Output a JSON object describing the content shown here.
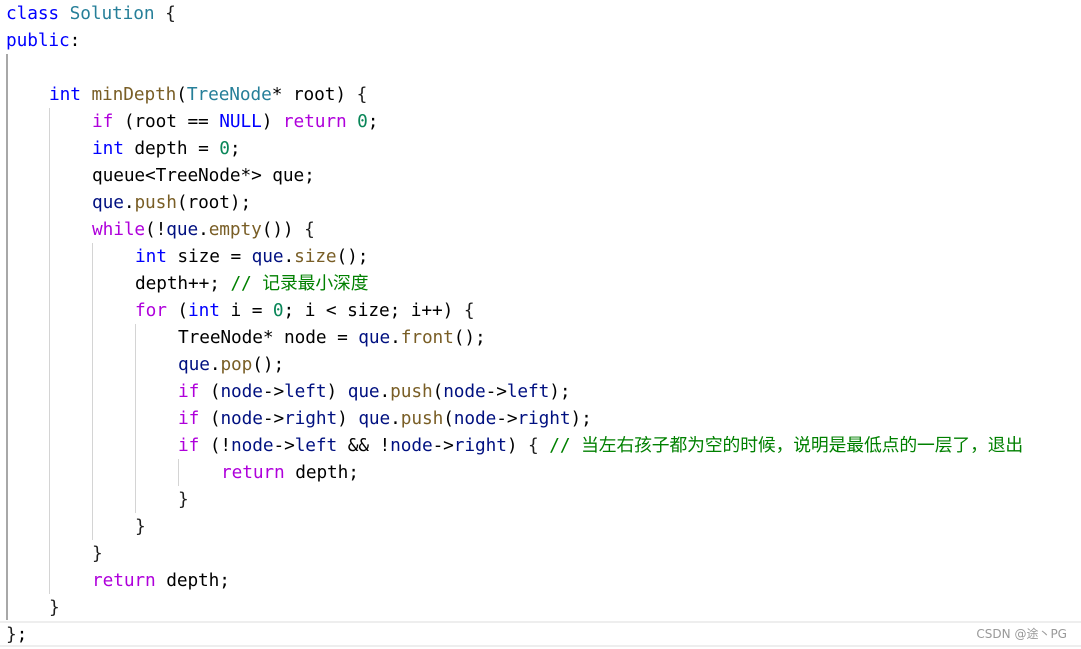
{
  "editor": {
    "language": "cpp",
    "lines": [
      {
        "indent": 0,
        "tokens": [
          [
            "kw",
            "class"
          ],
          [
            "t",
            " "
          ],
          [
            "type",
            "Solution"
          ],
          [
            "t",
            " "
          ],
          [
            "brk",
            "{"
          ]
        ]
      },
      {
        "indent": 0,
        "tokens": [
          [
            "kw",
            "public"
          ],
          [
            "t",
            ":"
          ]
        ]
      },
      {
        "indent": 0,
        "tokens": []
      },
      {
        "indent": 1,
        "tokens": [
          [
            "kw",
            "int"
          ],
          [
            "t",
            " "
          ],
          [
            "fn",
            "minDepth"
          ],
          [
            "t",
            "("
          ],
          [
            "type",
            "TreeNode"
          ],
          [
            "t",
            "* root) "
          ],
          [
            "brk",
            "{"
          ]
        ]
      },
      {
        "indent": 2,
        "tokens": [
          [
            "ctrl",
            "if"
          ],
          [
            "t",
            " (root == "
          ],
          [
            "kw",
            "NULL"
          ],
          [
            "t",
            ") "
          ],
          [
            "ctrl",
            "return"
          ],
          [
            "t",
            " "
          ],
          [
            "num",
            "0"
          ],
          [
            "t",
            ";"
          ]
        ]
      },
      {
        "indent": 2,
        "tokens": [
          [
            "kw",
            "int"
          ],
          [
            "t",
            " depth = "
          ],
          [
            "num",
            "0"
          ],
          [
            "t",
            ";"
          ]
        ]
      },
      {
        "indent": 2,
        "tokens": [
          [
            "t",
            "queue<TreeNode*> que;"
          ]
        ]
      },
      {
        "indent": 2,
        "tokens": [
          [
            "var",
            "que"
          ],
          [
            "t",
            "."
          ],
          [
            "fn",
            "push"
          ],
          [
            "t",
            "(root);"
          ]
        ]
      },
      {
        "indent": 2,
        "tokens": [
          [
            "ctrl",
            "while"
          ],
          [
            "t",
            "(!"
          ],
          [
            "var",
            "que"
          ],
          [
            "t",
            "."
          ],
          [
            "fn",
            "empty"
          ],
          [
            "t",
            "()) "
          ],
          [
            "brk",
            "{"
          ]
        ]
      },
      {
        "indent": 3,
        "tokens": [
          [
            "kw",
            "int"
          ],
          [
            "t",
            " size = "
          ],
          [
            "var",
            "que"
          ],
          [
            "t",
            "."
          ],
          [
            "fn",
            "size"
          ],
          [
            "t",
            "();"
          ]
        ]
      },
      {
        "indent": 3,
        "tokens": [
          [
            "t",
            "depth++; "
          ],
          [
            "cmt",
            "// "
          ],
          [
            "cmtcjk",
            "记录最小深度"
          ]
        ]
      },
      {
        "indent": 3,
        "tokens": [
          [
            "ctrl",
            "for"
          ],
          [
            "t",
            " ("
          ],
          [
            "kw",
            "int"
          ],
          [
            "t",
            " i = "
          ],
          [
            "num",
            "0"
          ],
          [
            "t",
            "; i < size; i++) "
          ],
          [
            "brk",
            "{"
          ]
        ]
      },
      {
        "indent": 4,
        "tokens": [
          [
            "t",
            "TreeNode* node = "
          ],
          [
            "var",
            "que"
          ],
          [
            "t",
            "."
          ],
          [
            "fn",
            "front"
          ],
          [
            "t",
            "();"
          ]
        ]
      },
      {
        "indent": 4,
        "tokens": [
          [
            "var",
            "que"
          ],
          [
            "t",
            "."
          ],
          [
            "fn",
            "pop"
          ],
          [
            "t",
            "();"
          ]
        ]
      },
      {
        "indent": 4,
        "tokens": [
          [
            "ctrl",
            "if"
          ],
          [
            "t",
            " ("
          ],
          [
            "var",
            "node"
          ],
          [
            "t",
            "->"
          ],
          [
            "var",
            "left"
          ],
          [
            "t",
            ") "
          ],
          [
            "var",
            "que"
          ],
          [
            "t",
            "."
          ],
          [
            "fn",
            "push"
          ],
          [
            "t",
            "("
          ],
          [
            "var",
            "node"
          ],
          [
            "t",
            "->"
          ],
          [
            "var",
            "left"
          ],
          [
            "t",
            ");"
          ]
        ]
      },
      {
        "indent": 4,
        "tokens": [
          [
            "ctrl",
            "if"
          ],
          [
            "t",
            " ("
          ],
          [
            "var",
            "node"
          ],
          [
            "t",
            "->"
          ],
          [
            "var",
            "right"
          ],
          [
            "t",
            ") "
          ],
          [
            "var",
            "que"
          ],
          [
            "t",
            "."
          ],
          [
            "fn",
            "push"
          ],
          [
            "t",
            "("
          ],
          [
            "var",
            "node"
          ],
          [
            "t",
            "->"
          ],
          [
            "var",
            "right"
          ],
          [
            "t",
            ");"
          ]
        ]
      },
      {
        "indent": 4,
        "tokens": [
          [
            "ctrl",
            "if"
          ],
          [
            "t",
            " (!"
          ],
          [
            "var",
            "node"
          ],
          [
            "t",
            "->"
          ],
          [
            "var",
            "left"
          ],
          [
            "t",
            " && !"
          ],
          [
            "var",
            "node"
          ],
          [
            "t",
            "->"
          ],
          [
            "var",
            "right"
          ],
          [
            "t",
            ") "
          ],
          [
            "brk",
            "{"
          ],
          [
            "t",
            " "
          ],
          [
            "cmt",
            "// "
          ],
          [
            "cmtcjk",
            "当左右孩子都为空的时候，说明是最低点的一层了，退出"
          ]
        ]
      },
      {
        "indent": 5,
        "tokens": [
          [
            "ctrl",
            "return"
          ],
          [
            "t",
            " depth;"
          ]
        ]
      },
      {
        "indent": 4,
        "tokens": [
          [
            "brk",
            "}"
          ]
        ]
      },
      {
        "indent": 3,
        "tokens": [
          [
            "brk",
            "}"
          ]
        ]
      },
      {
        "indent": 2,
        "tokens": [
          [
            "brk",
            "}"
          ]
        ]
      },
      {
        "indent": 2,
        "tokens": [
          [
            "ctrl",
            "return"
          ],
          [
            "t",
            " depth;"
          ]
        ]
      },
      {
        "indent": 1,
        "tokens": [
          [
            "brk",
            "}"
          ]
        ]
      },
      {
        "indent": 0,
        "tokens": [
          [
            "brk",
            "}"
          ],
          [
            "t",
            ";"
          ]
        ]
      }
    ]
  },
  "watermark": "CSDN @途丶PG"
}
